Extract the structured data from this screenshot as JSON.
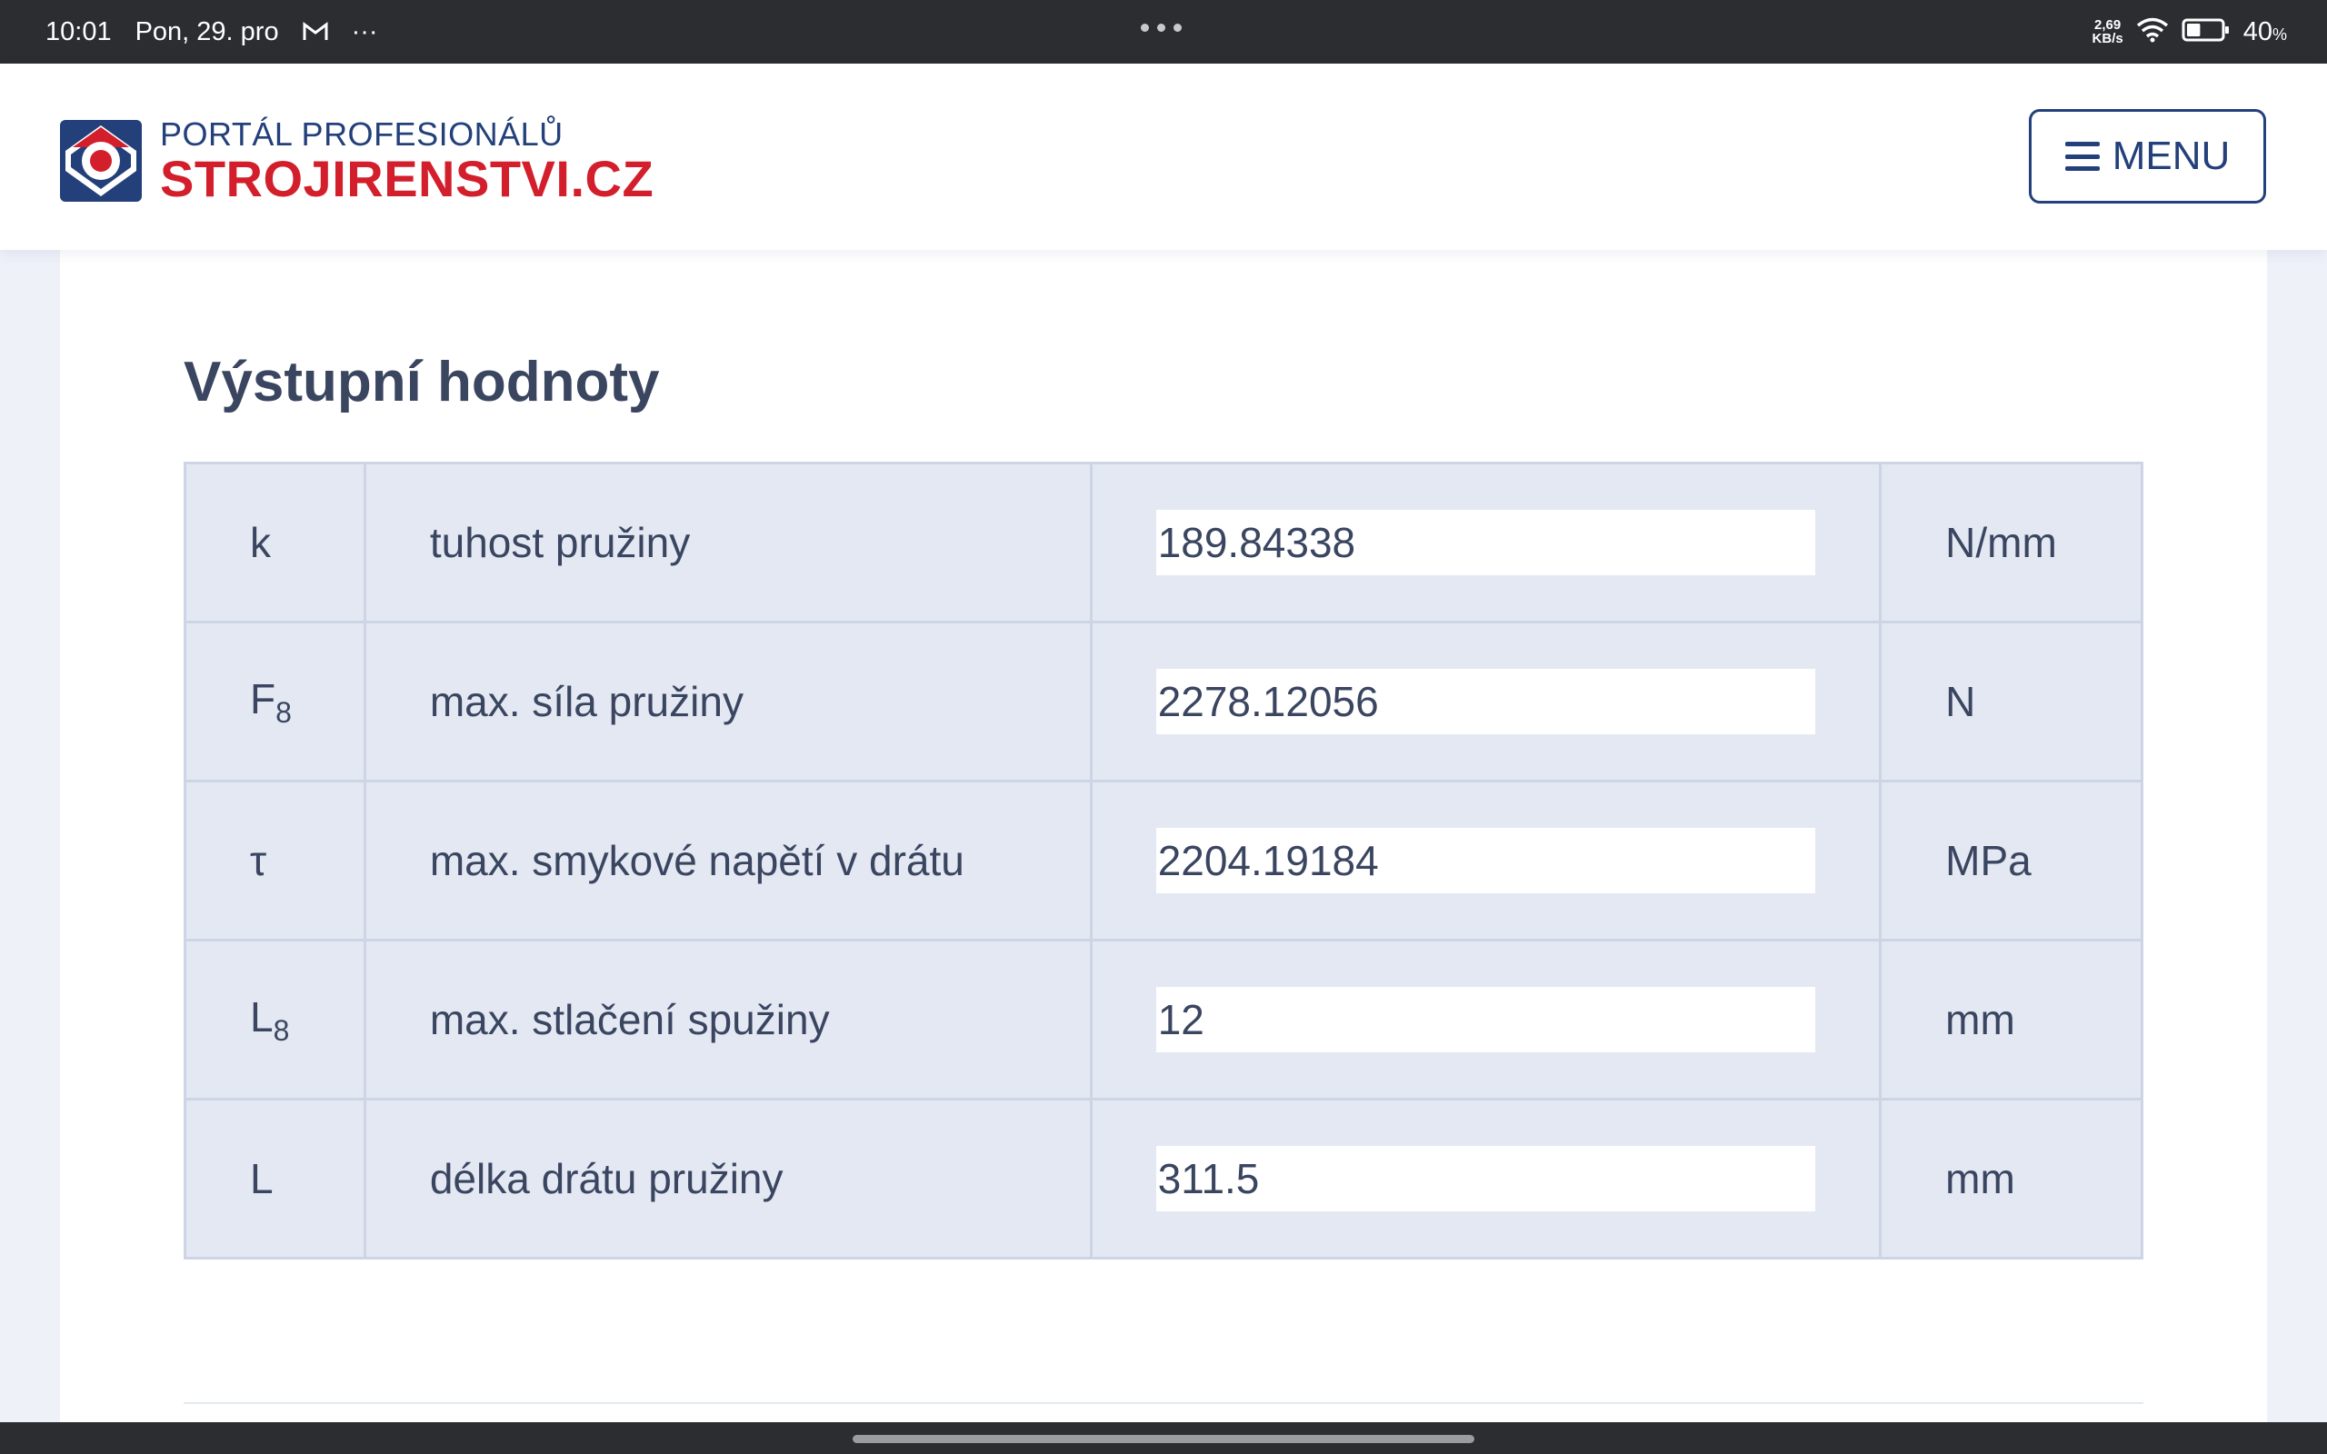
{
  "status_bar": {
    "time": "10:01",
    "date": "Pon, 29. pro",
    "overflow": "···",
    "net_speed_value": "2,69",
    "net_speed_unit": "KB/s",
    "battery_percent": "40",
    "battery_percent_sign": "%",
    "battery_level": 0.4,
    "icons": [
      "gmail-icon",
      "wifi-icon",
      "battery-icon"
    ]
  },
  "header": {
    "logo_top": "PORTÁL PROFESIONÁLŮ",
    "logo_bottom": "STROJIRENSTVI.CZ",
    "menu_label": "MENU",
    "brand_blue": "#23407a",
    "brand_red": "#d21f2b"
  },
  "section": {
    "title": "Výstupní hodnoty"
  },
  "table": {
    "rows": [
      {
        "symbol": "k",
        "subscript": "",
        "description": "tuhost pružiny",
        "value": "189.84338",
        "unit": "N/mm"
      },
      {
        "symbol": "F",
        "subscript": "8",
        "description": "max. síla pružiny",
        "value": "2278.12056",
        "unit": "N"
      },
      {
        "symbol": "τ",
        "subscript": "",
        "description": "max. smykové napětí v drátu",
        "value": "2204.19184",
        "unit": "MPa"
      },
      {
        "symbol": "L",
        "subscript": "8",
        "description": "max. stlačení spužiny",
        "value": "12",
        "unit": "mm"
      },
      {
        "symbol": "L",
        "subscript": "",
        "description": "délka drátu pružiny",
        "value": "311.5",
        "unit": "mm"
      }
    ]
  },
  "colors": {
    "status_bar_bg": "#2b2d31",
    "page_bg": "#eef1f8",
    "table_bg": "#e3e8f3",
    "text": "#3a4560"
  }
}
